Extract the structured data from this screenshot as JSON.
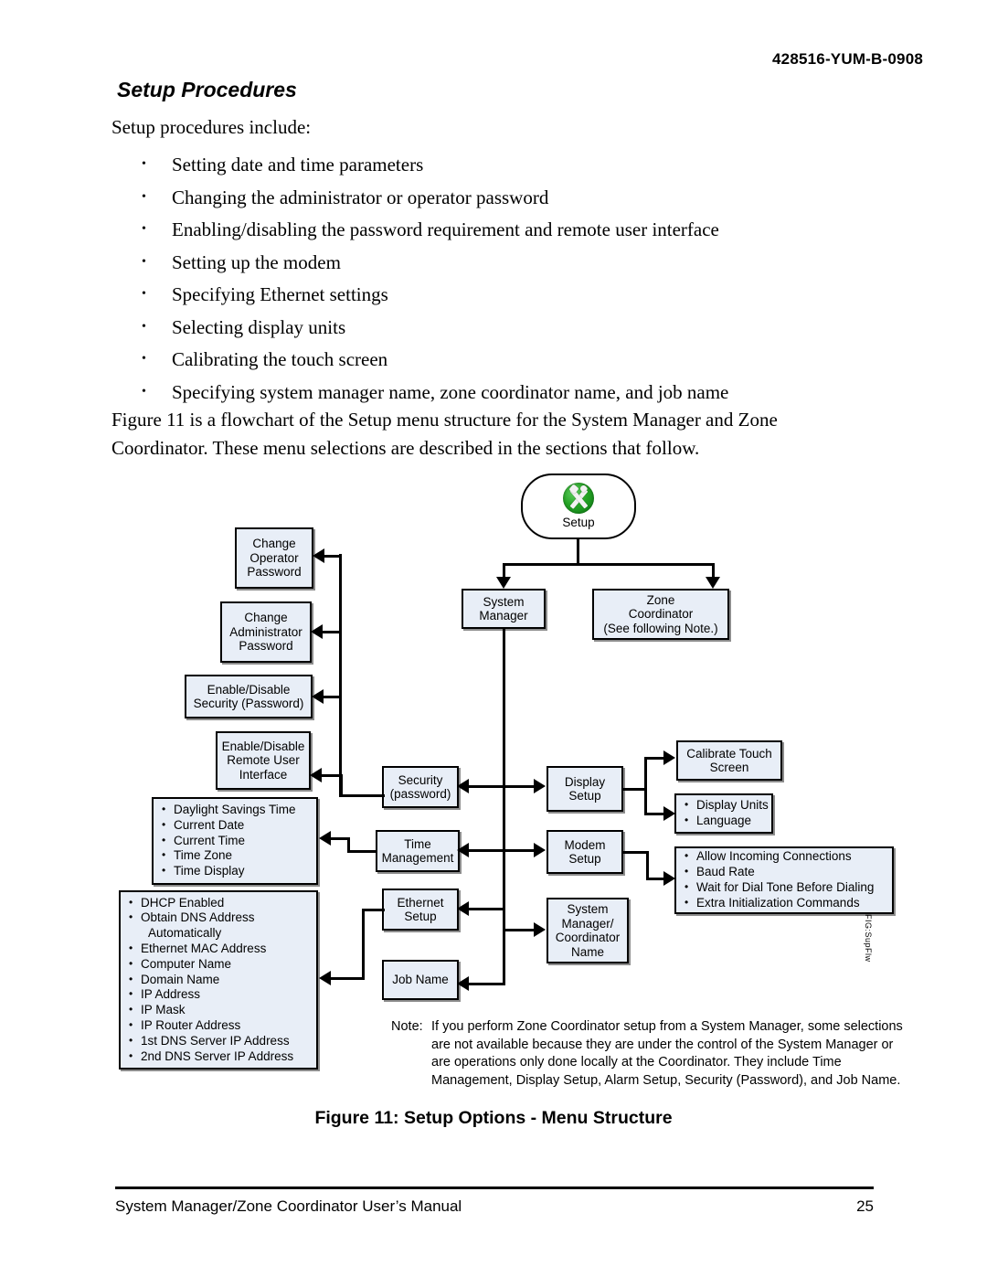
{
  "header": {
    "doc_code": "428516-YUM-B-0908",
    "section_title": "Setup Procedures",
    "lead": "Setup procedures include:",
    "bullets": [
      "Setting date and time parameters",
      "Changing the administrator or operator password",
      "Enabling/disabling the password requirement and remote user interface",
      "Setting up the modem",
      "Specifying Ethernet settings",
      "Selecting display units",
      "Calibrating the touch screen",
      "Specifying system manager name, zone coordinator name, and job name"
    ],
    "paragraph": "Figure 11 is a flowchart of the Setup menu structure for the System Manager and Zone Coordinator. These menu selections are described in the sections that follow."
  },
  "figure": {
    "root": {
      "icon": "setup-tools-icon",
      "label": "Setup"
    },
    "branches": {
      "system_manager": "System\nManager",
      "system_manager_line1": "System",
      "system_manager_line2": "Manager",
      "zone_coordinator_line1": "Zone",
      "zone_coordinator_line2": "Coordinator",
      "zone_coordinator_line3": "(See following Note.)"
    },
    "password_nodes": [
      {
        "id": "change-operator-password",
        "lines": [
          "Change",
          "Operator",
          "Password"
        ]
      },
      {
        "id": "change-administrator-password",
        "lines": [
          "Change",
          "Administrator",
          "Password"
        ]
      },
      {
        "id": "enable-disable-security",
        "lines": [
          "Enable/Disable",
          "Security (Password)"
        ]
      },
      {
        "id": "enable-disable-remote-user-interface",
        "lines": [
          "Enable/Disable",
          "Remote User",
          "Interface"
        ]
      }
    ],
    "menu_nodes": [
      {
        "id": "security-password",
        "lines": [
          "Security",
          "(password)"
        ]
      },
      {
        "id": "time-management",
        "lines": [
          "Time",
          "Management"
        ]
      },
      {
        "id": "ethernet-setup",
        "lines": [
          "Ethernet",
          "Setup"
        ]
      },
      {
        "id": "job-name",
        "lines": [
          "Job Name"
        ]
      },
      {
        "id": "display-setup",
        "lines": [
          "Display",
          "Setup"
        ]
      },
      {
        "id": "modem-setup",
        "lines": [
          "Modem",
          "Setup"
        ]
      },
      {
        "id": "system-manager-coordinator-name",
        "lines": [
          "System",
          "Manager/",
          "Coordinator",
          "Name"
        ]
      }
    ],
    "detail_nodes": {
      "time_management_items": [
        "Daylight Savings Time",
        "Current Date",
        "Current Time",
        "Time Zone",
        "Time Display"
      ],
      "ethernet_items": [
        "DHCP Enabled",
        "Obtain DNS Address",
        "Automatically",
        "Ethernet MAC Address",
        "Computer Name",
        "Domain Name",
        "IP Address",
        "IP Mask",
        "IP Router Address",
        "1st DNS Server IP Address",
        "2nd DNS Server IP Address"
      ],
      "calibrate_lines": [
        "Calibrate Touch",
        "Screen"
      ],
      "display_items": [
        "Display Units",
        "Language"
      ],
      "modem_items": [
        "Allow Incoming Connections",
        "Baud Rate",
        "Wait for Dial Tone Before Dialing",
        "Extra Initialization Commands"
      ]
    },
    "side_code": "FIG:SupFlw",
    "note": {
      "label": "Note:",
      "text": "If you perform Zone Coordinator setup from a System Manager, some selections are not available because they are under the control of the System Manager or are operations only done locally at the Coordinator. They include Time Management, Display Setup, Alarm Setup, Security (Password), and Job Name."
    },
    "caption": "Figure 11: Setup Options - Menu Structure"
  },
  "footer": {
    "left": "System Manager/Zone Coordinator User’s Manual",
    "page": "25"
  },
  "colors": {
    "node_fill": "#e8eef7",
    "node_border": "#000000",
    "icon_green": "#25a425"
  }
}
